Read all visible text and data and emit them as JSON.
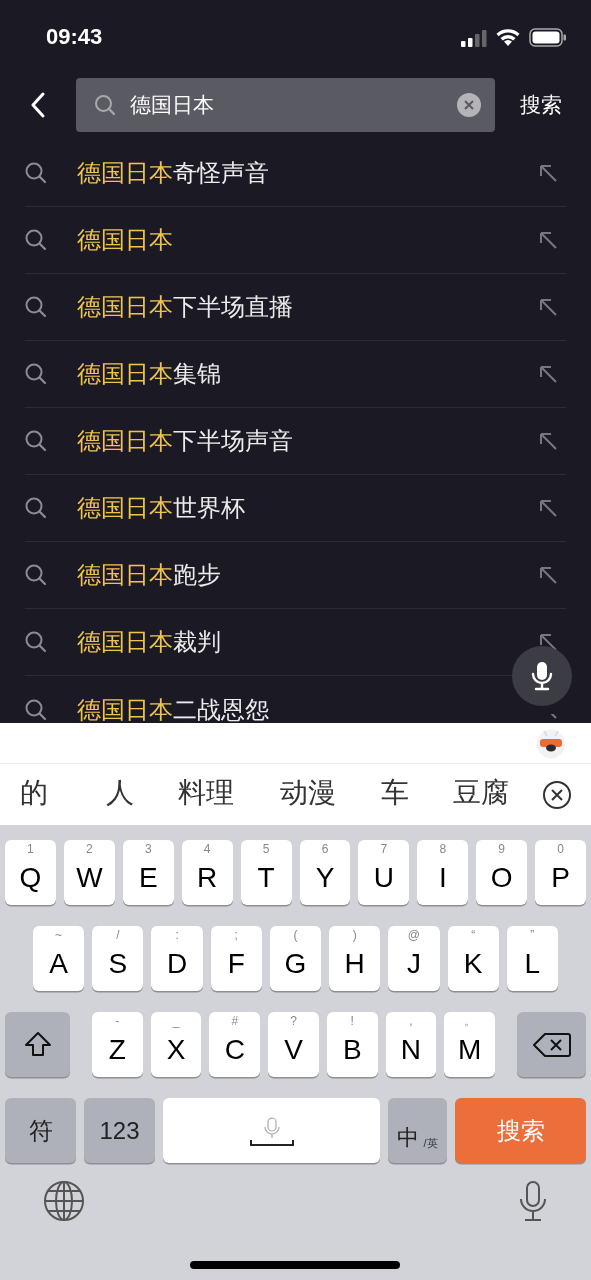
{
  "status_bar": {
    "time": "09:43"
  },
  "search_bar": {
    "query": "德国日本",
    "action": "搜索"
  },
  "suggestions": [
    {
      "match": "德国日本",
      "rest": "奇怪声音"
    },
    {
      "match": "德国日本"
    },
    {
      "match": "德国日本",
      "rest": "下半场直播"
    },
    {
      "match": "德国日本",
      "rest": "集锦"
    },
    {
      "match": "德国日本",
      "rest": "下半场声音"
    },
    {
      "match": "德国日本",
      "rest": "世界杯"
    },
    {
      "match": "德国日本",
      "rest": "跑步"
    },
    {
      "match": "德国日本",
      "rest": "裁判"
    },
    {
      "match": "德国日本",
      "rest": "二战恩怨"
    }
  ],
  "candidates": [
    "的",
    "人",
    "料理",
    "动漫",
    "车",
    "豆腐"
  ],
  "keyboard": {
    "top_row": [
      {
        "kind": "letter",
        "hint": "1",
        "label": "Q"
      },
      {
        "kind": "letter",
        "hint": "2",
        "label": "W"
      },
      {
        "kind": "letter",
        "hint": "3",
        "label": "E"
      },
      {
        "kind": "letter",
        "hint": "4",
        "label": "R"
      },
      {
        "kind": "letter",
        "hint": "5",
        "label": "T"
      },
      {
        "kind": "letter",
        "hint": "6",
        "label": "Y"
      },
      {
        "kind": "letter",
        "hint": "7",
        "label": "U"
      },
      {
        "kind": "letter",
        "hint": "8",
        "label": "I"
      },
      {
        "kind": "letter",
        "hint": "9",
        "label": "O"
      },
      {
        "kind": "letter",
        "hint": "0",
        "label": "P"
      }
    ],
    "middle_row": [
      {
        "kind": "letter",
        "hint": "~",
        "label": "A"
      },
      {
        "kind": "letter",
        "hint": "/",
        "label": "S"
      },
      {
        "kind": "letter",
        "hint": ":",
        "label": "D"
      },
      {
        "kind": "letter",
        "hint": ";",
        "label": "F"
      },
      {
        "kind": "letter",
        "hint": "(",
        "label": "G"
      },
      {
        "kind": "letter",
        "hint": ")",
        "label": "H"
      },
      {
        "kind": "letter",
        "hint": "@",
        "label": "J"
      },
      {
        "kind": "letter",
        "hint": "“",
        "label": "K"
      },
      {
        "kind": "letter",
        "hint": "”",
        "label": "L"
      }
    ],
    "lower_row": [
      {
        "kind": "shift"
      },
      {
        "kind": "letter",
        "hint": "-",
        "label": "Z"
      },
      {
        "kind": "letter",
        "hint": "_",
        "label": "X"
      },
      {
        "kind": "letter",
        "hint": "#",
        "label": "C"
      },
      {
        "kind": "letter",
        "hint": "?",
        "label": "V"
      },
      {
        "kind": "letter",
        "hint": "!",
        "label": "B"
      },
      {
        "kind": "letter",
        "hint": ",",
        "label": "N"
      },
      {
        "kind": "letter",
        "hint": "。",
        "label": "M"
      },
      {
        "kind": "backspace"
      }
    ],
    "function_row": [
      {
        "kind": "function",
        "label": "符"
      },
      {
        "kind": "function",
        "label": "123"
      },
      {
        "kind": "space"
      },
      {
        "kind": "language",
        "label": "中",
        "hint": "/英"
      },
      {
        "kind": "action",
        "label": "搜索"
      }
    ]
  }
}
